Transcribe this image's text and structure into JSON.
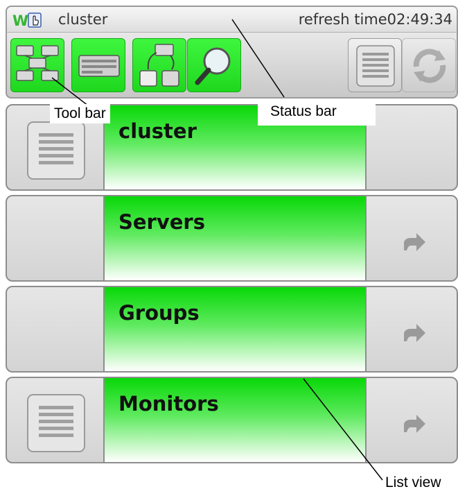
{
  "status_bar": {
    "logo": "W",
    "title": "cluster",
    "refresh_label": "refresh time02:49:34"
  },
  "toolbar": {
    "buttons": [
      {
        "name": "cluster-network-icon",
        "style": "green"
      },
      {
        "name": "server-icon",
        "style": "green"
      },
      {
        "name": "replication-icon",
        "style": "green"
      },
      {
        "name": "search-icon",
        "style": "green"
      },
      {
        "name": "list-icon",
        "style": "grey"
      },
      {
        "name": "refresh-icon",
        "style": "grey-faded"
      }
    ]
  },
  "list": {
    "rows": [
      {
        "label": "cluster",
        "has_list_icon": true,
        "has_arrow": false
      },
      {
        "label": "Servers",
        "has_list_icon": false,
        "has_arrow": true
      },
      {
        "label": "Groups",
        "has_list_icon": false,
        "has_arrow": true
      },
      {
        "label": "Monitors",
        "has_list_icon": true,
        "has_arrow": true
      }
    ]
  },
  "annotations": {
    "tool_bar": "Tool bar",
    "status_bar": "Status bar",
    "list_view": "List view"
  },
  "colors": {
    "accent_green": "#1ed81e",
    "row_border": "#8d8d8d",
    "logo_green": "#35b534"
  }
}
